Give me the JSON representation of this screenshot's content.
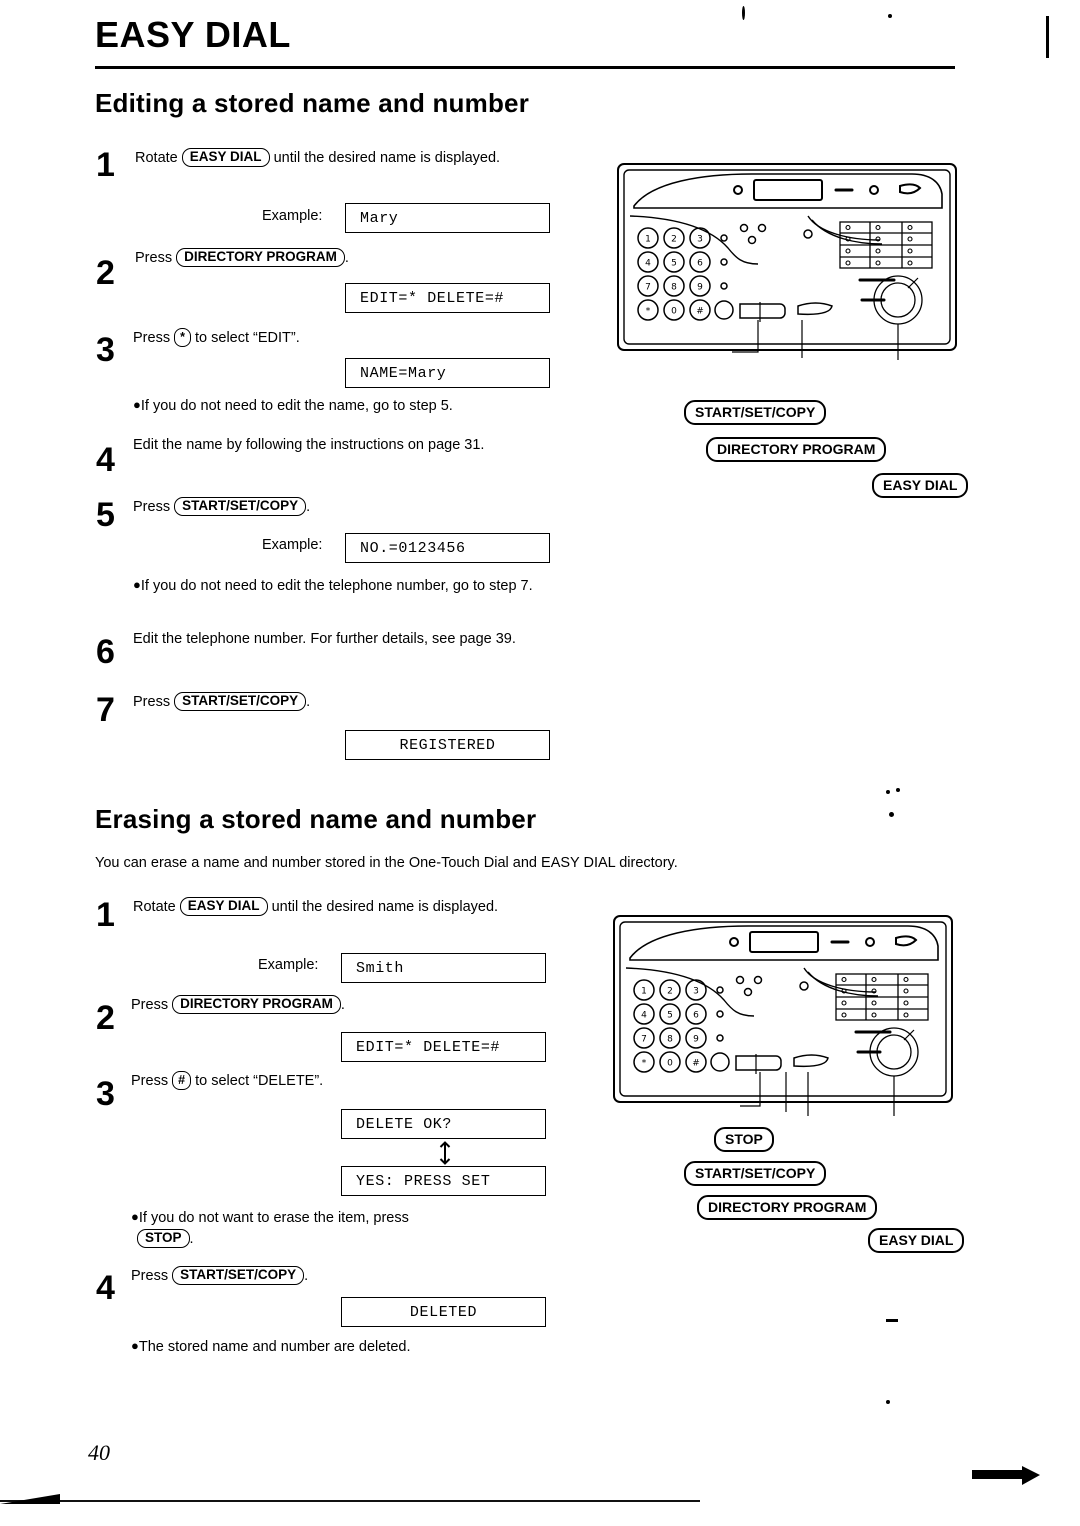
{
  "document": {
    "title": "EASY DIAL",
    "page_number": "40"
  },
  "section_editing": {
    "heading": "Editing a stored name and number",
    "steps": [
      {
        "num": "1",
        "text_before": "Rotate",
        "key": "EASY DIAL",
        "text_after": "until the desired name is displayed.",
        "example_label": "Example:",
        "display": "Mary"
      },
      {
        "num": "2",
        "text_before": "Press",
        "key": "DIRECTORY PROGRAM",
        "text_after": ".",
        "display": "EDIT=* DELETE=#"
      },
      {
        "num": "3",
        "text_before": "Press",
        "key": "*",
        "text_after": "to select “EDIT”.",
        "display": "NAME=Mary",
        "note": "If you do not need to edit the name, go to step 5."
      },
      {
        "num": "4",
        "text": "Edit the name by following the instructions on page 31."
      },
      {
        "num": "5",
        "text_before": "Press",
        "key": "START/SET/COPY",
        "text_after": ".",
        "example_label": "Example:",
        "display": "NO.=0123456",
        "note": "If you do not need to edit the telephone number, go to step 7."
      },
      {
        "num": "6",
        "text": "Edit the telephone number. For further details, see page 39."
      },
      {
        "num": "7",
        "text_before": "Press",
        "key": "START/SET/COPY",
        "text_after": ".",
        "display": "REGISTERED"
      }
    ],
    "callouts": [
      "START/SET/COPY",
      "DIRECTORY PROGRAM",
      "EASY DIAL"
    ]
  },
  "section_erasing": {
    "heading": "Erasing a stored name and number",
    "intro": "You can erase a name and number stored in the One-Touch Dial and EASY DIAL directory.",
    "steps": [
      {
        "num": "1",
        "text_before": "Rotate",
        "key": "EASY DIAL",
        "text_after": "until the desired name is displayed.",
        "example_label": "Example:",
        "display": "Smith"
      },
      {
        "num": "2",
        "text_before": "Press",
        "key": "DIRECTORY PROGRAM",
        "text_after": ".",
        "display": "EDIT=* DELETE=#"
      },
      {
        "num": "3",
        "text_before": "Press",
        "key": "#",
        "text_after": "to select “DELETE”.",
        "display": "DELETE OK?",
        "display2": "YES: PRESS SET",
        "note_before": "If you do not want to erase the item, press",
        "note_key": "STOP",
        "note_after": "."
      },
      {
        "num": "4",
        "text_before": "Press",
        "key": "START/SET/COPY",
        "text_after": ".",
        "display": "DELETED",
        "note": "The stored name and number are deleted."
      }
    ],
    "callouts": [
      "STOP",
      "START/SET/COPY",
      "DIRECTORY PROGRAM",
      "EASY DIAL"
    ]
  },
  "keypad": {
    "rows": [
      [
        "1",
        "2",
        "3"
      ],
      [
        "4",
        "5",
        "6"
      ],
      [
        "7",
        "8",
        "9"
      ],
      [
        "*",
        "0",
        "#"
      ]
    ]
  }
}
